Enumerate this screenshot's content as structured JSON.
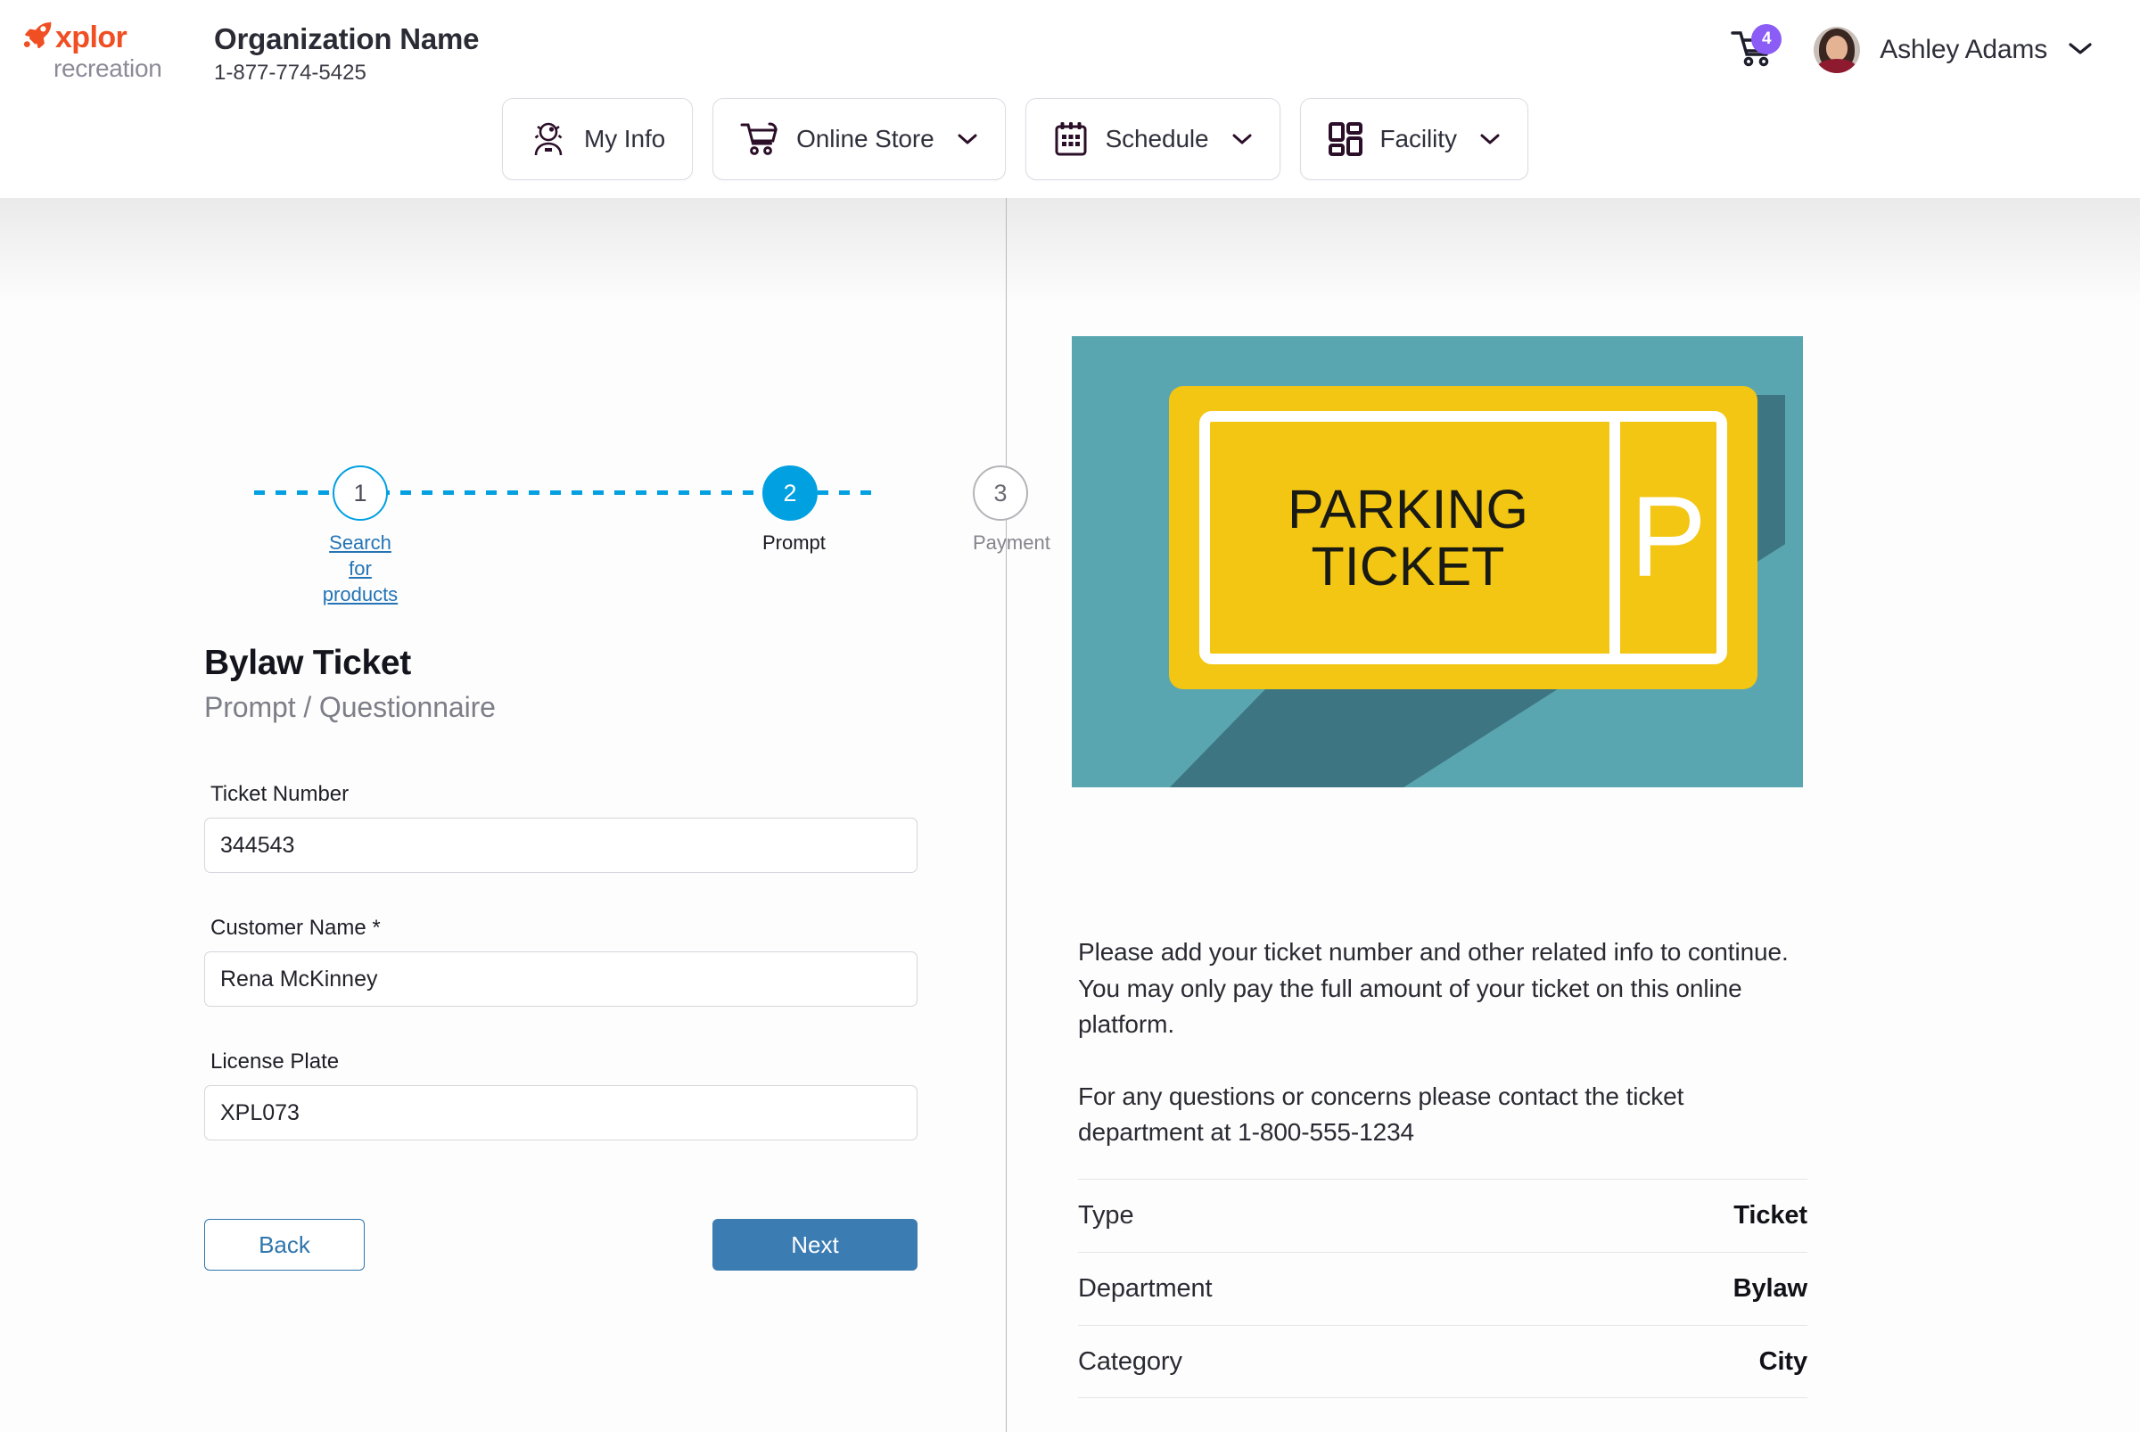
{
  "header": {
    "logo": {
      "icon": "rocket-icon",
      "brand_primary": "xplor",
      "brand_secondary": "recreation"
    },
    "organization_name": "Organization Name",
    "organization_phone": "1-877-774-5425",
    "nav": [
      {
        "label": "My Info",
        "icon": "astronaut-person-icon",
        "caret": false
      },
      {
        "label": "Online Store",
        "icon": "shopping-cart-icon",
        "caret": true
      },
      {
        "label": "Schedule",
        "icon": "calendar-icon",
        "caret": true
      },
      {
        "label": "Facility",
        "icon": "grid-blocks-icon",
        "caret": true
      }
    ],
    "cart": {
      "icon": "shopping-cart-icon",
      "badge_count": "4",
      "badge_color": "#8b5cf6"
    },
    "user": {
      "name": "Ashley Adams",
      "avatar": "user-avatar",
      "caret": "chevron-down-icon"
    }
  },
  "stepper": {
    "steps": [
      {
        "number": "1",
        "label": "Search for products",
        "state": "done"
      },
      {
        "number": "2",
        "label": "Prompt",
        "state": "active"
      },
      {
        "number": "3",
        "label": "Payment",
        "state": "todo"
      }
    ],
    "accent_color": "#00a0e1"
  },
  "form_panel": {
    "title": "Bylaw Ticket",
    "subtitle": "Prompt / Questionnaire",
    "fields": [
      {
        "label": "Ticket Number",
        "value": "344543",
        "placeholder": ""
      },
      {
        "label": "Customer Name *",
        "value": "Rena McKinney",
        "placeholder": ""
      },
      {
        "label": "License Plate",
        "value": "XPL073",
        "placeholder": ""
      }
    ],
    "buttons": {
      "back": "Back",
      "next": "Next",
      "next_color": "#3b7cb3",
      "back_color": "#2f76ad"
    }
  },
  "detail_panel": {
    "image": {
      "name": "parking-ticket-illustration",
      "line1": "PARKING",
      "line2": "TICKET",
      "badge_letter": "P",
      "background_color": "#5aa6b0",
      "shadow_color": "#3d7682",
      "ticket_color": "#f2c612"
    },
    "paragraphs": [
      "Please add your ticket number and other related info to continue. You may only pay the full amount of your ticket on this online platform.",
      "For any questions or concerns please contact the ticket department at 1-800-555-1234"
    ],
    "details": [
      {
        "key": "Type",
        "value": "Ticket"
      },
      {
        "key": "Department",
        "value": "Bylaw"
      },
      {
        "key": "Category",
        "value": "City"
      }
    ]
  }
}
